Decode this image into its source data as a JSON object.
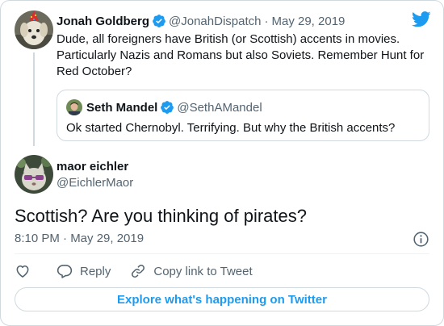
{
  "colors": {
    "accent": "#1d9bf0",
    "text_primary": "#0f1419",
    "text_secondary": "#536471",
    "border": "#cfd9de"
  },
  "parent_tweet": {
    "display_name": "Jonah Goldberg",
    "handle": "@JonahDispatch",
    "separator": "·",
    "date": "May 29, 2019",
    "text": "Dude, all foreigners have British (or Scottish) accents in movies. Particularly Nazis and Romans but also Soviets. Remember Hunt for Red October?",
    "verified_icon": "verified-badge-icon",
    "avatar_icon": "dog-avatar"
  },
  "quoted_tweet": {
    "display_name": "Seth Mandel",
    "handle": "@SethAMandel",
    "text": "Ok started Chernobyl. Terrifying. But why the British accents?",
    "verified_icon": "verified-badge-icon"
  },
  "main_tweet": {
    "display_name": "maor eichler",
    "handle": "@EichlerMaor",
    "text": "Scottish? Are you thinking of pirates?",
    "timestamp": "8:10 PM · May 29, 2019"
  },
  "actions": {
    "like_icon": "heart-icon",
    "reply_label": "Reply",
    "copy_label": "Copy link to Tweet"
  },
  "footer": {
    "explore_label": "Explore what's happening on Twitter"
  },
  "brand": {
    "logo_icon": "twitter-bird-icon"
  }
}
